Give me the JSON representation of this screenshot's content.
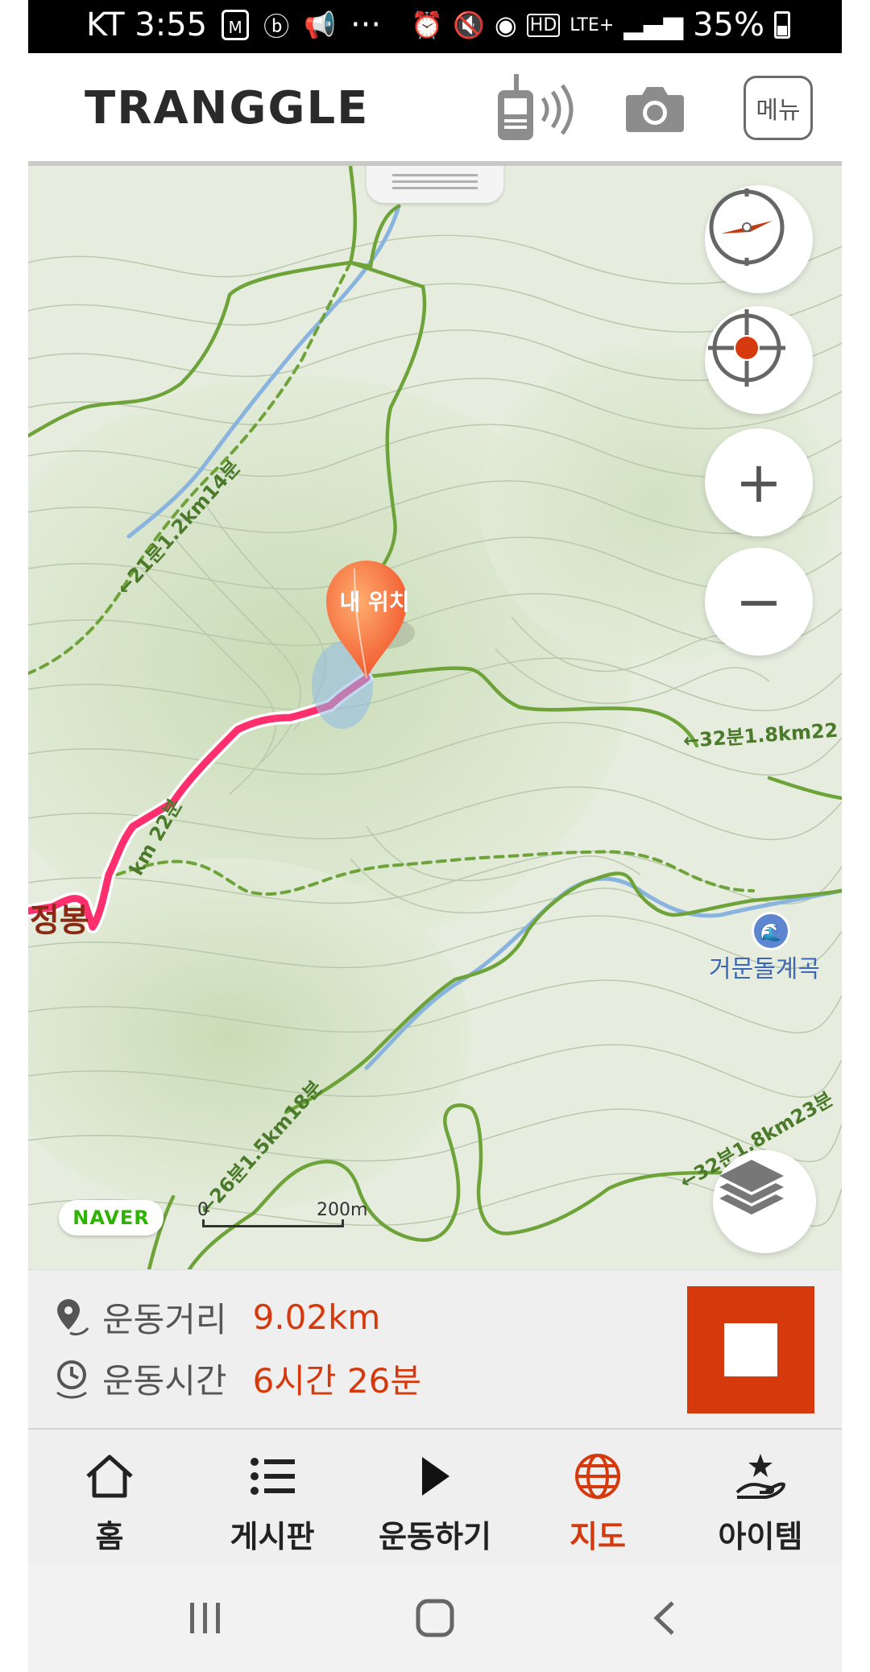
{
  "status_bar": {
    "carrier_time": "KT 3:55",
    "battery": "35%",
    "overflow": "···",
    "network": "LTE+"
  },
  "header": {
    "logo": "TRANGGLE",
    "menu_label": "메뉴",
    "icons": [
      "walkie-talkie-icon",
      "camera-icon"
    ]
  },
  "map": {
    "pin_label": "내 위치",
    "place_label": "거문돌계곡",
    "poi_glyph": "🌊",
    "peak_label": "정봉",
    "naver": "NAVER",
    "scale_start": "0",
    "scale_end": "200m",
    "zoom_in": "+",
    "zoom_out": "−",
    "trail_labels": [
      "←21분1.2km14분",
      "←32분1.8km22",
      "←26분1.5km18분",
      "←32분1.8km23분",
      "km 22분"
    ]
  },
  "stats": {
    "distance_label": "운동거리",
    "distance_value": "9.02km",
    "time_label": "운동시간",
    "time_value": "6시간 26분"
  },
  "nav": {
    "items": [
      {
        "label": "홈",
        "icon": "home-icon"
      },
      {
        "label": "게시판",
        "icon": "list-icon"
      },
      {
        "label": "운동하기",
        "icon": "play-icon"
      },
      {
        "label": "지도",
        "icon": "globe-icon"
      },
      {
        "label": "아이템",
        "icon": "star-hand-icon"
      }
    ],
    "active": "지도"
  },
  "colors": {
    "accent": "#d63a0c",
    "track": "#ff2f6e",
    "trail": "#6ea33a",
    "stream": "#8ab4e0"
  }
}
